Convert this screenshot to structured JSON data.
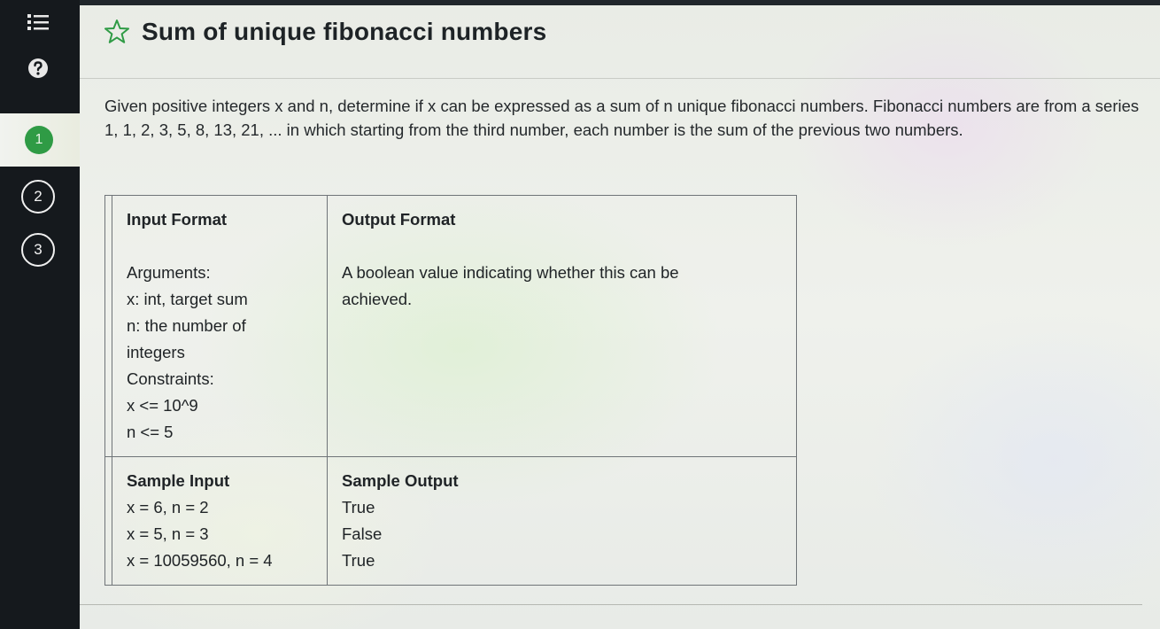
{
  "sidebar": {
    "menu_icon": "list-icon",
    "help_icon": "help-circle-icon",
    "steps": [
      {
        "label": "1",
        "state": "active"
      },
      {
        "label": "2",
        "state": "inactive"
      },
      {
        "label": "3",
        "state": "inactive"
      }
    ],
    "active_color": "#2f9b45"
  },
  "problem": {
    "star_icon": "star-outline-icon",
    "star_color": "#2f9b45",
    "title": "Sum of unique fibonacci numbers",
    "description": "Given positive integers x and n, determine if x can be expressed as a sum of n unique fibonacci numbers. Fibonacci numbers are from a series 1, 1, 2, 3, 5, 8, 13, 21, ... in which starting from the third number, each number is the sum of the previous two numbers.",
    "table": {
      "input_format": {
        "header": "Input Format",
        "lines": [
          "Arguments:",
          "x: int, target sum",
          "n: the number of",
          "integers",
          "Constraints:",
          "x <= 10^9",
          "n <= 5"
        ]
      },
      "output_format": {
        "header": "Output Format",
        "text": "A boolean value indicating whether this can be achieved."
      },
      "sample_input": {
        "header": "Sample Input",
        "lines": [
          "x = 6, n = 2",
          "x = 5, n = 3",
          "x = 10059560, n = 4"
        ]
      },
      "sample_output": {
        "header": "Sample Output",
        "lines": [
          "True",
          "False",
          "True"
        ]
      }
    }
  }
}
